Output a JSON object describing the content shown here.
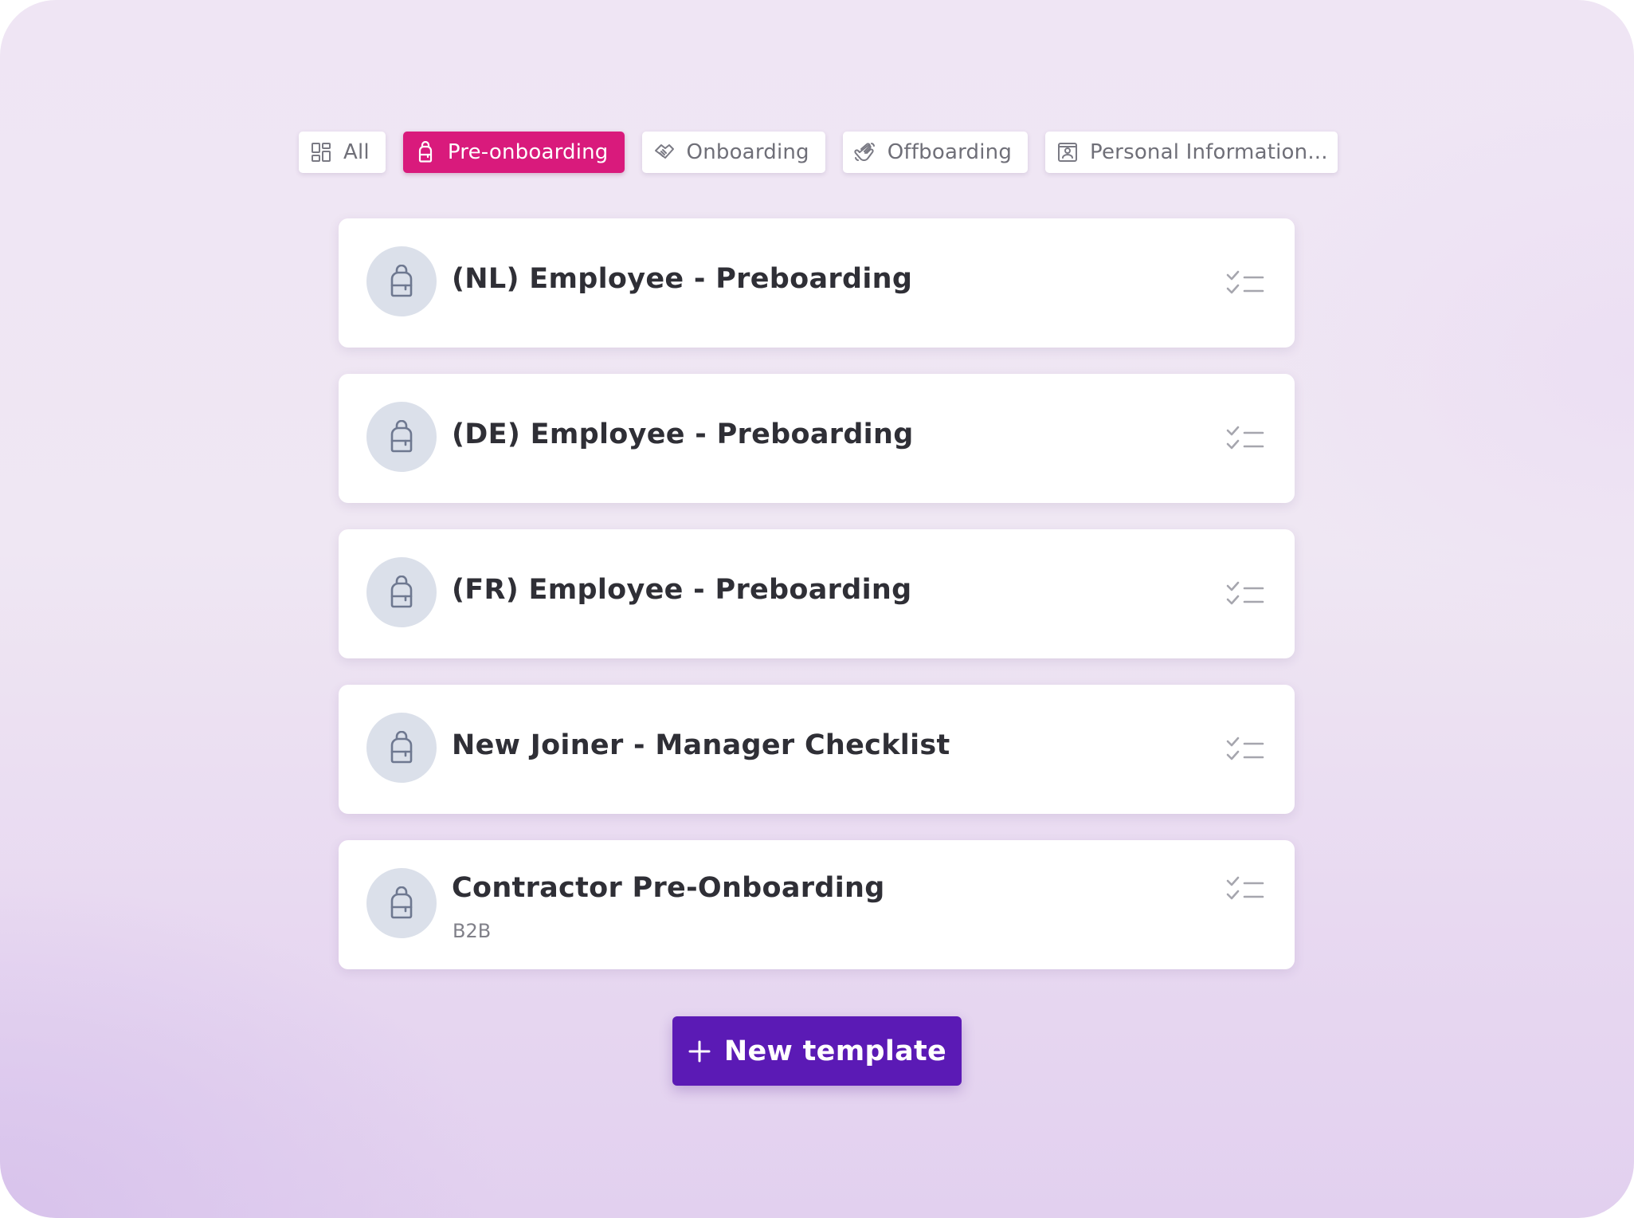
{
  "tabs": [
    {
      "label": "All",
      "icon": "grid-icon",
      "active": false
    },
    {
      "label": "Pre-onboarding",
      "icon": "backpack-icon",
      "active": true
    },
    {
      "label": "Onboarding",
      "icon": "handshake-icon",
      "active": false
    },
    {
      "label": "Offboarding",
      "icon": "waving-hand-icon",
      "active": false
    },
    {
      "label": "Personal Information...",
      "icon": "id-card-icon",
      "active": false
    }
  ],
  "templates": [
    {
      "title": "(NL) Employee - Preboarding",
      "subtitle": "",
      "icon": "backpack-icon",
      "action_icon": "checklist-icon"
    },
    {
      "title": "(DE) Employee - Preboarding",
      "subtitle": "",
      "icon": "backpack-icon",
      "action_icon": "checklist-icon"
    },
    {
      "title": "(FR) Employee - Preboarding",
      "subtitle": "",
      "icon": "backpack-icon",
      "action_icon": "checklist-icon"
    },
    {
      "title": "New Joiner - Manager Checklist",
      "subtitle": "",
      "icon": "backpack-icon",
      "action_icon": "checklist-icon"
    },
    {
      "title": "Contractor Pre-Onboarding",
      "subtitle": "B2B",
      "icon": "backpack-icon",
      "action_icon": "checklist-icon"
    }
  ],
  "new_template_button": {
    "label": "New template",
    "icon": "plus-icon"
  },
  "colors": {
    "active_tab": "#d91a7c",
    "primary_button": "#5b1ab5",
    "avatar_bg": "#dbe0ea",
    "icon_gray": "#6e7890"
  }
}
